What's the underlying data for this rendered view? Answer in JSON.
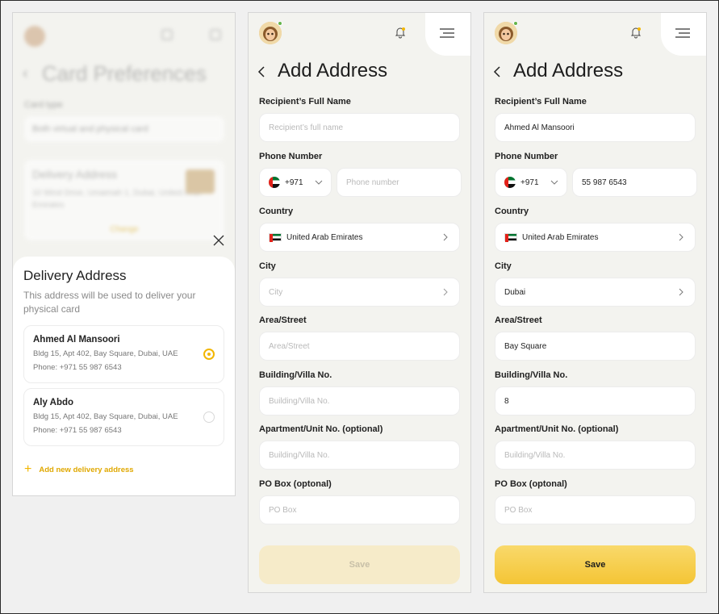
{
  "screen1": {
    "background": {
      "title": "Card Preferences",
      "card_type_label": "Card type",
      "card_type_value": "Both virtual and physical card",
      "delivery_title": "Delivery Address",
      "delivery_text": "10 Wind Drive, Umaimah 1, Dubai, United Arab Emirates",
      "change_label": "Change"
    },
    "sheet": {
      "title": "Delivery Address",
      "subtitle": "This address will be used to deliver your physical card",
      "addresses": [
        {
          "name": "Ahmed Al Mansoori",
          "address": "Bldg 15, Apt 402, Bay Square, Dubai, UAE",
          "phone": "Phone: +971 55 987 6543",
          "selected": true
        },
        {
          "name": "Aly Abdo",
          "address": "Bldg 15, Apt 402, Bay Square, Dubai, UAE",
          "phone": "Phone: +971 55 987 6543",
          "selected": false
        }
      ],
      "add_new_label": "Add new delivery address",
      "accent_color": "#f2b600"
    }
  },
  "form_empty": {
    "title": "Add Address",
    "labels": {
      "full_name": "Recipient’s Full Name",
      "phone": "Phone Number",
      "country": "Country",
      "city": "City",
      "street": "Area/Street",
      "building": "Building/Villa No.",
      "apartment": "Apartment/Unit No. (optional)",
      "po_box": "PO Box (optonal)"
    },
    "placeholders": {
      "full_name": "Recipient’s full name",
      "phone": "Phone number",
      "city": "City",
      "street": "Area/Street",
      "building": "Building/Villa No.",
      "apartment": "Building/Villa No.",
      "po_box": "PO Box"
    },
    "country_code": "+971",
    "country": "United Arab Emirates",
    "save_label": "Save",
    "save_state": "disabled"
  },
  "form_filled": {
    "title": "Add Address",
    "labels": {
      "full_name": "Recipient’s Full Name",
      "phone": "Phone Number",
      "country": "Country",
      "city": "City",
      "street": "Area/Street",
      "building": "Building/Villa No.",
      "apartment": "Apartment/Unit No. (optional)",
      "po_box": "PO Box (optonal)"
    },
    "values": {
      "full_name": "Ahmed Al Mansoori",
      "phone": "55 987 6543",
      "city": "Dubai",
      "street": "Bay Square",
      "building": "8"
    },
    "placeholders": {
      "apartment": "Building/Villa No.",
      "po_box": "PO Box"
    },
    "country_code": "+971",
    "country": "United Arab Emirates",
    "save_label": "Save",
    "save_state": "enabled"
  },
  "icons": {
    "avatar": "user-avatar",
    "bell": "bell-icon",
    "menu": "menu-icon",
    "back": "chevron-left-icon",
    "close": "close-icon",
    "plus": "plus-icon"
  },
  "colors": {
    "accent": "#f2b600",
    "save_active": "#f4c535",
    "save_disabled": "#f6ebc9"
  }
}
